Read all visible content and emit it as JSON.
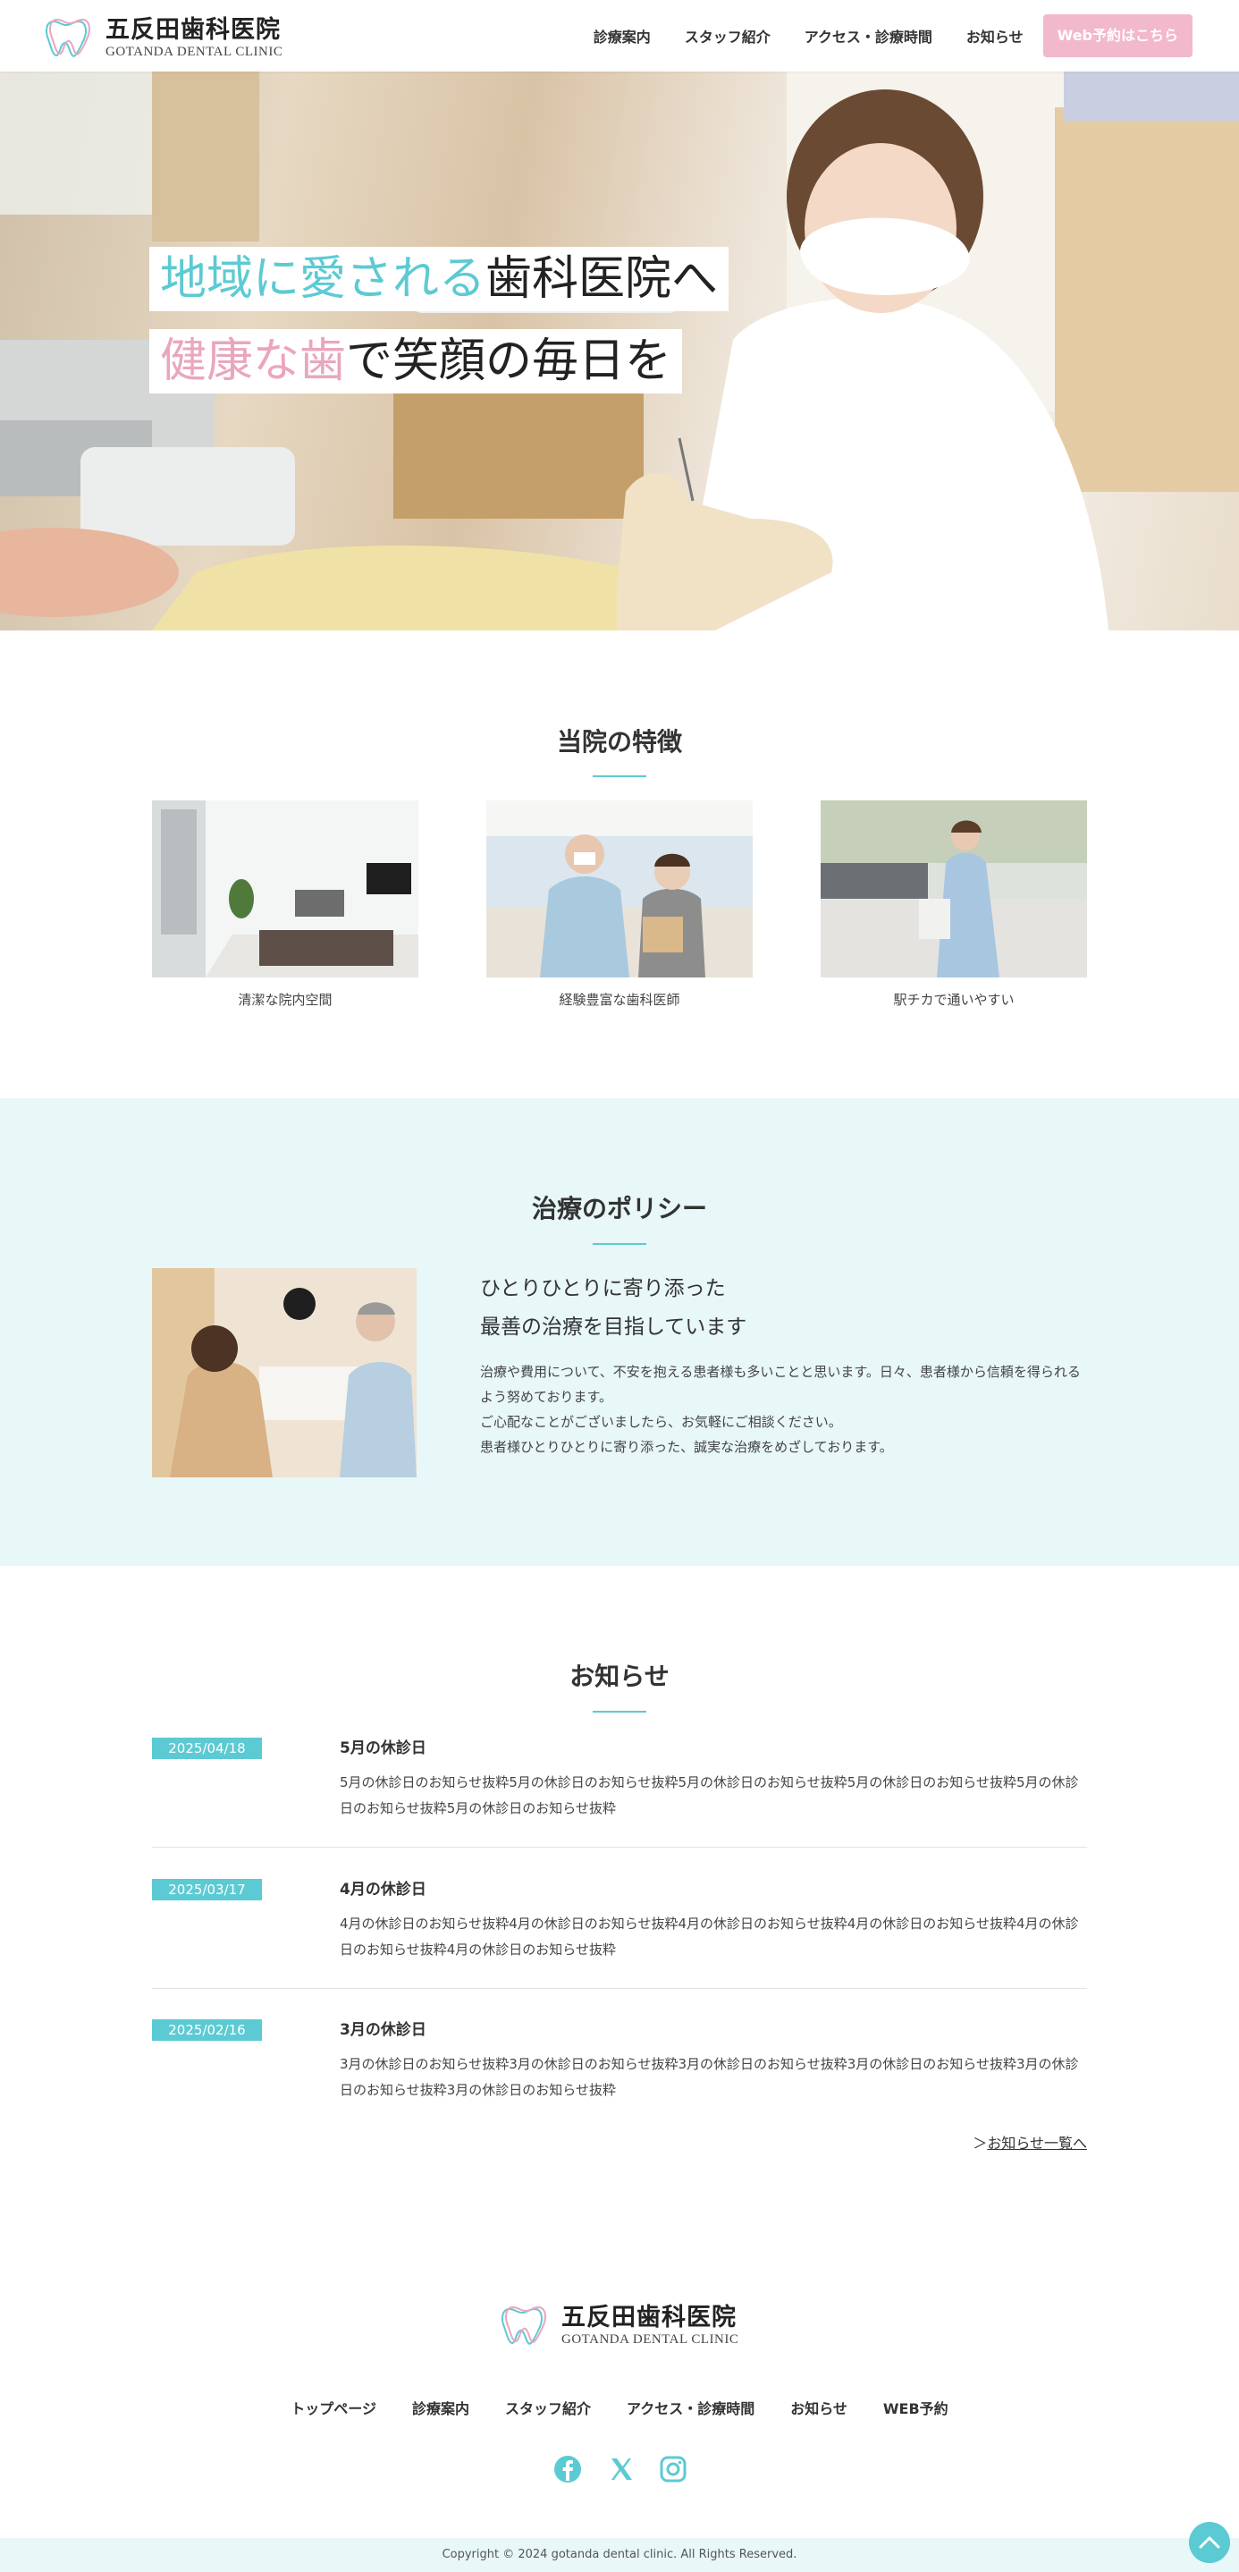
{
  "header": {
    "logo_jp": "五反田歯科医院",
    "logo_en": "GOTANDA DENTAL CLINIC",
    "nav": [
      "診療案内",
      "スタッフ紹介",
      "アクセス・診療時間",
      "お知らせ"
    ],
    "cta": "Web予約はこちら"
  },
  "hero": {
    "line1_accent": "地域に愛される",
    "line1_rest": "歯科医院へ",
    "line2_accent": "健康な歯",
    "line2_rest": "で笑顔の毎日を"
  },
  "features": {
    "title": "当院の特徴",
    "items": [
      {
        "caption": "清潔な院内空間"
      },
      {
        "caption": "経験豊富な歯科医師"
      },
      {
        "caption": "駅チカで通いやすい"
      }
    ]
  },
  "policy": {
    "title": "治療のポリシー",
    "heading1": "ひとりひとりに寄り添った",
    "heading2": "最善の治療を目指しています",
    "p1": "治療や費用について、不安を抱える患者様も多いことと思います。日々、患者様から信頼を得られるよう努めております。",
    "p2": "ご心配なことがございましたら、お気軽にご相談ください。",
    "p3": "患者様ひとりひとりに寄り添った、誠実な治療をめざしております。"
  },
  "news": {
    "title": "お知らせ",
    "items": [
      {
        "date": "2025/04/18",
        "title": "5月の休診日",
        "body": "5月の休診日のお知らせ抜粋5月の休診日のお知らせ抜粋5月の休診日のお知らせ抜粋5月の休診日のお知らせ抜粋5月の休診日のお知らせ抜粋5月の休診日のお知らせ抜粋"
      },
      {
        "date": "2025/03/17",
        "title": "4月の休診日",
        "body": "4月の休診日のお知らせ抜粋4月の休診日のお知らせ抜粋4月の休診日のお知らせ抜粋4月の休診日のお知らせ抜粋4月の休診日のお知らせ抜粋4月の休診日のお知らせ抜粋"
      },
      {
        "date": "2025/02/16",
        "title": "3月の休診日",
        "body": "3月の休診日のお知らせ抜粋3月の休診日のお知らせ抜粋3月の休診日のお知らせ抜粋3月の休診日のお知らせ抜粋3月の休診日のお知らせ抜粋3月の休診日のお知らせ抜粋"
      }
    ],
    "more_prefix": "＞",
    "more_label": "お知らせ一覧へ"
  },
  "footer": {
    "logo_jp": "五反田歯科医院",
    "logo_en": "GOTANDA DENTAL CLINIC",
    "nav": [
      "トップページ",
      "診療案内",
      "スタッフ紹介",
      "アクセス・診療時間",
      "お知らせ",
      "WEB予約"
    ],
    "social": [
      "facebook-icon",
      "x-icon",
      "instagram-icon"
    ],
    "copyright": "Copyright © 2024 gotanda dental clinic. All Rights Reserved."
  },
  "colors": {
    "accent": "#5ccad3",
    "pink": "#f2b8cb",
    "light_bg": "#e8f7f8"
  }
}
